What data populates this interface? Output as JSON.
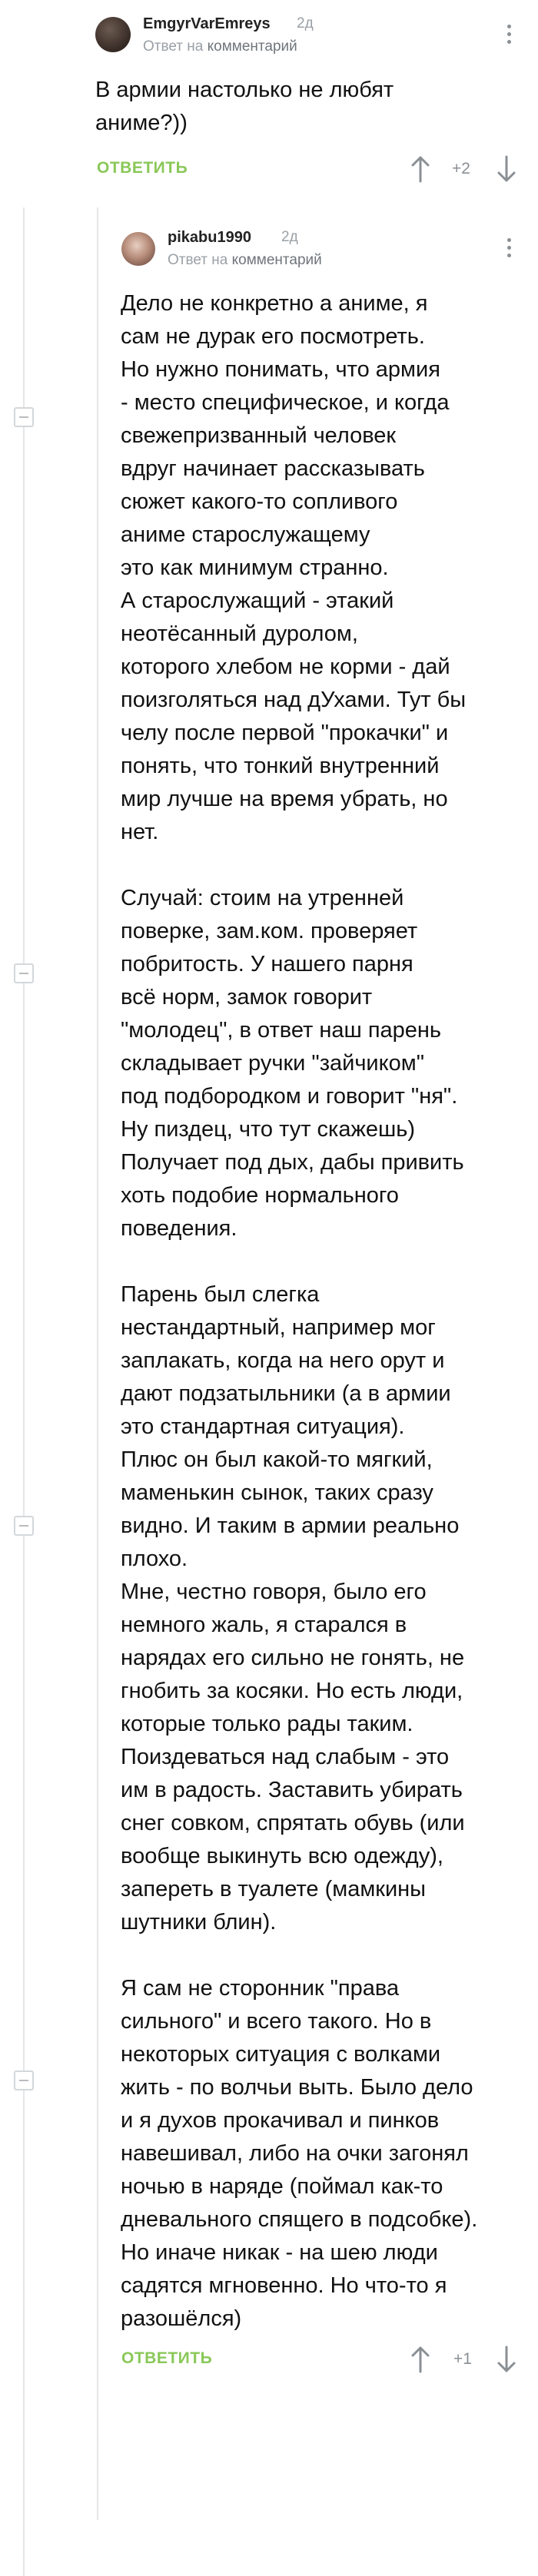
{
  "comment1": {
    "username": "EmgyrVarEmreys",
    "time": "2д",
    "reply_prefix": "Ответ на",
    "reply_link": "комментарий",
    "text": "В армии настолько не любят\nаниме?))",
    "reply_label": "ОТВЕТИТЬ",
    "score": "+2"
  },
  "comment2": {
    "username": "pikabu1990",
    "time": "2д",
    "reply_prefix": "Ответ на",
    "reply_link": "комментарий",
    "text": "Дело не конкретно а аниме, я\nсам не дурак его посмотреть.\nНо нужно понимать, что армия\n- место специфическое, и когда\nсвежепризванный человек\nвдруг начинает рассказывать\nсюжет какого-то сопливого\nаниме старослужащему\nэто как минимум странно.\nА старослужащий - этакий\nнеотёсанный дуролом,\nкоторого хлебом не корми - дай\nпоизголяться над дУхами. Тут бы\nчелу после первой \"прокачки\" и\nпонять, что тонкий внутренний\nмир лучше на время убрать, но\nнет.\n\nСлучай: стоим на утренней\nповерке, зам.ком. проверяет\nпобритость. У нашего парня\nвсё норм, замок говорит\n\"молодец\", в ответ наш парень\nскладывает ручки \"зайчиком\"\nпод подбородком и говорит \"ня\".\nНу пиздец, что тут скажешь)\nПолучает под дых, дабы привить\nхоть подобие нормального\nповедения.\n\nПарень был слегка\nнестандартный, например мог\nзаплакать, когда на него орут и\nдают подзатыльники (а в армии\nэто стандартная ситуация).\nПлюс он был какой-то мягкий,\nмаменькин сынок, таких сразу\nвидно. И таким в армии реально\nплохо.\nМне, честно говоря, было его\nнемного жаль, я старался в\nнарядах его сильно не гонять, не\nгнобить за косяки. Но есть люди,\nкоторые только рады таким.\nПоиздеваться над слабым - это\nим в радость. Заставить убирать\nснег совком, спрятать обувь (или\nвообще выкинуть всю одежду),\nзапереть в туалете (мамкины\nшутники блин).\n\nЯ сам не сторонник \"права\nсильного\" и всего такого. Но в\nнекоторых ситуация с волками\nжить - по волчьи выть. Было дело\nи я духов прокачивал и пинков\nнавешивал, либо на очки загонял\nночью в наряде (поймал как-то\nдневального спящего в подсобке).\nНо иначе никак - на шею люди\nсадятся мгновенно. Но что-то я\nразошёлся)",
    "reply_label": "ОТВЕТИТЬ",
    "score": "+1"
  },
  "colors": {
    "accent": "#8ac858",
    "muted": "#9aa0a6",
    "thread_line": "#e4e6e8"
  },
  "icons": [
    "more-vertical-icon",
    "arrow-up-icon",
    "arrow-down-icon",
    "collapse-icon"
  ]
}
